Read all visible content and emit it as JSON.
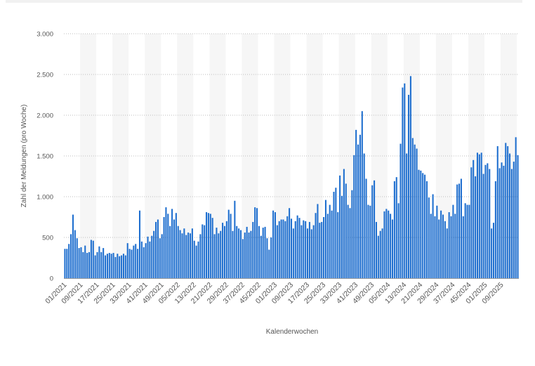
{
  "chart_data": {
    "type": "bar",
    "xlabel": "Kalenderwochen",
    "ylabel": "Zahl der Meldungen (pro Woche)",
    "ylim": [
      0,
      3000
    ],
    "y_ticks": [
      "0",
      "500",
      "1.000",
      "1.500",
      "2.000",
      "2.500",
      "3.000"
    ],
    "x_tick_labels": [
      "01/2021",
      "09/2021",
      "17/2021",
      "25/2021",
      "33/2021",
      "41/2021",
      "49/2021",
      "05/2022",
      "13/2022",
      "21/2022",
      "29/2022",
      "37/2022",
      "45/2022",
      "01/2023",
      "09/2023",
      "17/2023",
      "25/2023",
      "33/2023",
      "41/2023",
      "49/2023",
      "05/2024",
      "13/2024",
      "21/2024",
      "29/2024",
      "37/2024",
      "45/2024",
      "01/2025",
      "09/2025"
    ],
    "grid": "horizontal-dotted",
    "bar_color": "#1f6fcf",
    "series": [
      {
        "values": [
          360,
          360,
          420,
          540,
          780,
          590,
          490,
          370,
          380,
          320,
          400,
          310,
          320,
          470,
          460,
          280,
          320,
          390,
          320,
          370,
          280,
          300,
          310,
          300,
          310,
          260,
          300,
          270,
          280,
          300,
          280,
          430,
          360,
          350,
          400,
          420,
          360,
          830,
          450,
          380,
          430,
          510,
          450,
          520,
          580,
          690,
          720,
          490,
          540,
          750,
          870,
          790,
          640,
          850,
          720,
          800,
          640,
          590,
          550,
          610,
          530,
          560,
          550,
          610,
          460,
          400,
          450,
          540,
          660,
          650,
          810,
          800,
          790,
          740,
          540,
          620,
          550,
          580,
          680,
          640,
          700,
          840,
          790,
          580,
          950,
          640,
          610,
          590,
          480,
          560,
          630,
          560,
          580,
          690,
          870,
          860,
          640,
          520,
          620,
          630,
          490,
          350,
          500,
          830,
          810,
          650,
          700,
          720,
          720,
          700,
          760,
          860,
          730,
          610,
          700,
          770,
          740,
          650,
          710,
          700,
          610,
          690,
          600,
          650,
          800,
          910,
          680,
          690,
          750,
          960,
          790,
          900,
          830,
          1060,
          1110,
          810,
          1260,
          1010,
          1340,
          1160,
          900,
          860,
          1080,
          1510,
          1820,
          1640,
          1760,
          2050,
          1530,
          1220,
          900,
          890,
          1140,
          1200,
          690,
          520,
          580,
          610,
          820,
          850,
          830,
          790,
          720,
          1190,
          1240,
          920,
          1650,
          2340,
          2390,
          1530,
          2250,
          2480,
          1720,
          1640,
          1590,
          1330,
          1320,
          1290,
          1270,
          1190,
          990,
          790,
          1030,
          760,
          890,
          720,
          830,
          780,
          700,
          610,
          810,
          760,
          900,
          790,
          1150,
          1160,
          1220,
          760,
          920,
          900,
          900,
          1360,
          1450,
          1250,
          1540,
          1520,
          1540,
          1280,
          1390,
          1410,
          1340,
          610,
          680,
          1190,
          1620,
          1350,
          1420,
          1380,
          1660,
          1620,
          1530,
          1340,
          1430,
          1730,
          1510
        ]
      }
    ]
  }
}
